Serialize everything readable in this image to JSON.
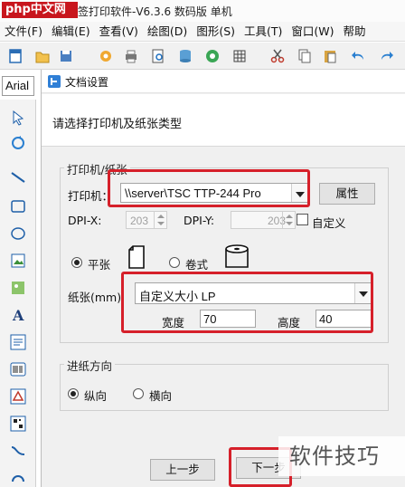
{
  "window": {
    "logo_text": "php中文网",
    "title": "签打印软件-V6.3.6 数码版 单机"
  },
  "menu": [
    "文件(F)",
    "编辑(E)",
    "查看(V)",
    "绘图(D)",
    "图形(S)",
    "工具(T)",
    "窗口(W)",
    "帮助"
  ],
  "toolbar_icons": [
    "new-file-icon",
    "open-folder-icon",
    "save-icon",
    "settings-gear-icon",
    "print-icon",
    "print-preview-icon",
    "database-icon",
    "cube-icon",
    "grid-icon",
    "cut-icon",
    "copy-icon",
    "paste-icon",
    "undo-icon",
    "redo-icon"
  ],
  "font_box": {
    "value": "Arial"
  },
  "sidebar_icons": [
    "pointer-icon",
    "rotate-icon",
    "line-icon",
    "rectangle-icon",
    "ellipse-icon",
    "image-icon",
    "picture-icon",
    "text-icon",
    "rich-text-icon",
    "barcode-icon",
    "triangle-icon",
    "qrcode-icon",
    "curve-icon",
    "arc-icon"
  ],
  "dialog": {
    "title": "文档设置",
    "prompt": "请选择打印机及纸张类型",
    "printer_group": {
      "label": "打印机/纸张",
      "printer_label": "打印机：",
      "printer_value": "\\\\server\\TSC TTP-244 Pro",
      "properties_button": "属性",
      "dpix_label": "DPI-X:",
      "dpix_value": "203",
      "dpiy_label": "DPI-Y:",
      "dpiy_value": "203",
      "custom_dpi_label": "自定义",
      "sheet_label": "平张",
      "roll_label": "卷式",
      "paper_label": "纸张(mm)",
      "paper_value": "自定义大小 LP",
      "width_label": "宽度",
      "width_value": "70",
      "height_label": "高度",
      "height_value": "40"
    },
    "orientation_group": {
      "label": "进纸方向",
      "portrait_label": "纵向",
      "landscape_label": "横向"
    },
    "prev_button": "上一步",
    "next_button": "下一步"
  },
  "watermark_bottom": "软件技巧",
  "colors": {
    "highlight_red": "#d6202a",
    "logo_red": "#c8161d"
  }
}
